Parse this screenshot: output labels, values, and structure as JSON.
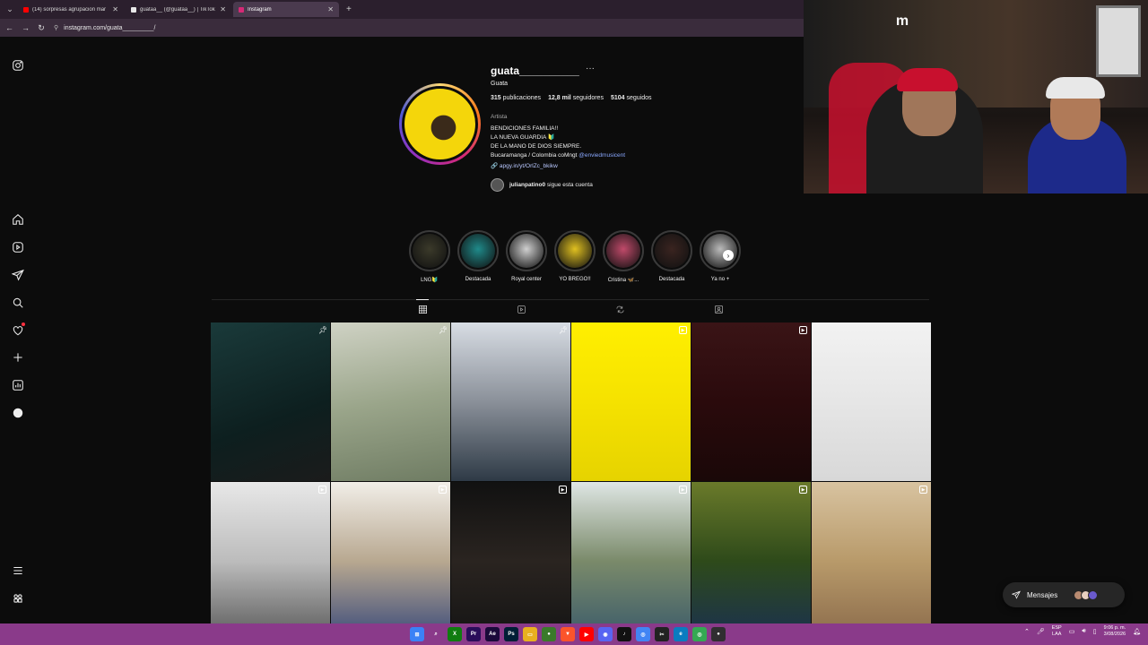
{
  "browser": {
    "tabs": [
      {
        "title": "(14) sorpresas agrupacion mar",
        "favicon_color": "#ff0000",
        "active": false
      },
      {
        "title": "guataa__ (@guataa__) | TikTok",
        "favicon_color": "#111111",
        "active": false
      },
      {
        "title": "Instagram",
        "favicon_color": "#d62976",
        "active": true
      }
    ],
    "new_tab": "+",
    "url": "instagram.com/guata_________/"
  },
  "profile": {
    "username": "guata__________",
    "more": "···",
    "full_name": "Guata",
    "stats": {
      "posts_num": "315",
      "posts_label": "publicaciones",
      "followers_num": "12,8 mil",
      "followers_label": "seguidores",
      "following_num": "5104",
      "following_label": "seguidos"
    },
    "category": "Artista",
    "bio": {
      "line1": "BENDICIONES FAMILIA!!",
      "line2": "LA NUEVA GUARDIA 🔰",
      "line3": "DE LA MANO DE DIOS SIEMPRE.",
      "line4": "Bucaramanga / Colombia coMngt ",
      "mention": "@enviedmusicent",
      "link": "🔗 apgy.in/yt/OrlZc_bkikw"
    },
    "followed_by": {
      "user": "julianpatino0",
      "text": " sigue esta cuenta"
    }
  },
  "highlights": [
    {
      "label": "LNG🔰",
      "color": "#3b3a2a"
    },
    {
      "label": "Destacada",
      "color": "#1f8a8a"
    },
    {
      "label": "Royal center",
      "color": "#cfcfcf"
    },
    {
      "label": "YO BREGO!!",
      "color": "#e0c020"
    },
    {
      "label": "Cristina 🦋...",
      "color": "#c04a6a"
    },
    {
      "label": "Destacada",
      "color": "#3a2420"
    },
    {
      "label": "Ya no +",
      "color": "#bbbbbb"
    }
  ],
  "posts": [
    {
      "bg": "linear-gradient(160deg,#1a3a3a,#0d1f1f 60%,#1b1b1b)",
      "badge": "pin"
    },
    {
      "bg": "linear-gradient(170deg,#cfd2c4,#9aa58a 50%,#6f7c63)",
      "badge": "pin"
    },
    {
      "bg": "linear-gradient(180deg,#d8dde4,#8a9099 50%,#2e3a46)",
      "badge": "pin"
    },
    {
      "bg": "linear-gradient(180deg,#ffef00,#f5e200 50%,#e6d300)",
      "badge": "reel"
    },
    {
      "bg": "linear-gradient(180deg,#3a1416,#2a0a0c 50%,#1a0808)",
      "badge": "reel"
    },
    {
      "bg": "linear-gradient(180deg,#f2f2f2,#e6e6e6 50%,#d8d8d8)",
      "badge": "none"
    },
    {
      "bg": "linear-gradient(180deg,#e8e8e8,#bcbcbc 50%,#5a5a5a)",
      "badge": "reel"
    },
    {
      "bg": "linear-gradient(180deg,#f1eee8,#b8a890 50%,#3a4a7a)",
      "badge": "reel"
    },
    {
      "bg": "linear-gradient(180deg,#111111,#2a2420 50%,#141414)",
      "badge": "reel"
    },
    {
      "bg": "linear-gradient(180deg,#dfe6e4,#7a8a6a 50%,#3a5a6a)",
      "badge": "reel"
    },
    {
      "bg": "linear-gradient(180deg,#6a7a2a,#2e4a1a 50%,#1a3050)",
      "badge": "reel"
    },
    {
      "bg": "linear-gradient(180deg,#d8c3a0,#b89a6a 50%,#8a6a4a)",
      "badge": "reel"
    }
  ],
  "messages": {
    "label": "Mensajes"
  },
  "taskbar": {
    "apps": [
      {
        "name": "windows",
        "glyph": "⊞",
        "color": "#3b82f6"
      },
      {
        "name": "search",
        "glyph": "⌕",
        "color": "transparent"
      },
      {
        "name": "xbox",
        "glyph": "X",
        "color": "#107c10"
      },
      {
        "name": "premiere",
        "glyph": "Pr",
        "color": "#2a0d5a"
      },
      {
        "name": "after-effects",
        "glyph": "Ae",
        "color": "#1a0a3a"
      },
      {
        "name": "photoshop",
        "glyph": "Ps",
        "color": "#001e36"
      },
      {
        "name": "explorer",
        "glyph": "▭",
        "color": "#e8b020"
      },
      {
        "name": "app-green",
        "glyph": "●",
        "color": "#3a7a2a"
      },
      {
        "name": "brave",
        "glyph": "▼",
        "color": "#fb542b"
      },
      {
        "name": "youtube",
        "glyph": "▶",
        "color": "#ff0000"
      },
      {
        "name": "discord",
        "glyph": "◉",
        "color": "#5865f2"
      },
      {
        "name": "tiktok",
        "glyph": "♪",
        "color": "#111111"
      },
      {
        "name": "chrome",
        "glyph": "◎",
        "color": "#4285f4"
      },
      {
        "name": "capcut",
        "glyph": "✂",
        "color": "#222222"
      },
      {
        "name": "edge",
        "glyph": "e",
        "color": "#0a7cc0"
      },
      {
        "name": "chrome-2",
        "glyph": "◎",
        "color": "#34a853"
      },
      {
        "name": "obs",
        "glyph": "●",
        "color": "#302e31"
      }
    ],
    "tray": {
      "lang_top": "ESP",
      "lang_bottom": "LAA",
      "time": "9:06 p. m.",
      "date": "3/08/2026"
    }
  }
}
